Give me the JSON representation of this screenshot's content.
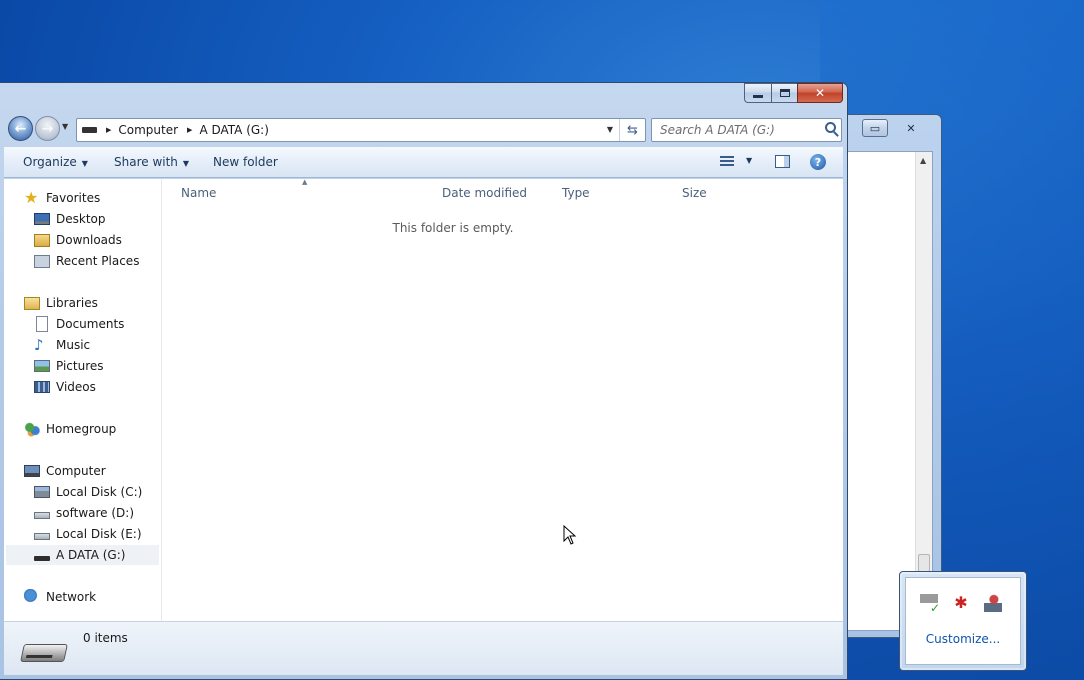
{
  "window": {
    "minimize": "",
    "maximize": "",
    "close": "✕"
  },
  "address": {
    "segments": [
      "Computer",
      "A DATA (G:)"
    ]
  },
  "search": {
    "placeholder": "Search A DATA (G:)"
  },
  "toolbar": {
    "organize": "Organize",
    "share_with": "Share with",
    "new_folder": "New folder",
    "help": "?"
  },
  "nav": {
    "favorites": {
      "label": "Favorites",
      "items": [
        "Desktop",
        "Downloads",
        "Recent Places"
      ]
    },
    "libraries": {
      "label": "Libraries",
      "items": [
        "Documents",
        "Music",
        "Pictures",
        "Videos"
      ]
    },
    "homegroup": "Homegroup",
    "computer": {
      "label": "Computer",
      "items": [
        "Local Disk (C:)",
        "software (D:)",
        "Local Disk (E:)",
        "A DATA (G:)"
      ],
      "selected": "A DATA (G:)"
    },
    "network": "Network"
  },
  "columns": [
    "Name",
    "Date modified",
    "Type",
    "Size"
  ],
  "empty_message": "This folder is empty.",
  "details": {
    "item_count": "0 items"
  },
  "tray": {
    "customize": "Customize..."
  },
  "icons": {
    "back": "back-arrow-icon",
    "forward": "forward-arrow-icon",
    "search": "magnifier-icon",
    "refresh": "refresh-icon"
  },
  "colors": {
    "desktop": "#1560c2",
    "window_frame": "#b4cbe8",
    "close_button": "#c0412a",
    "link": "#0e55a8"
  }
}
